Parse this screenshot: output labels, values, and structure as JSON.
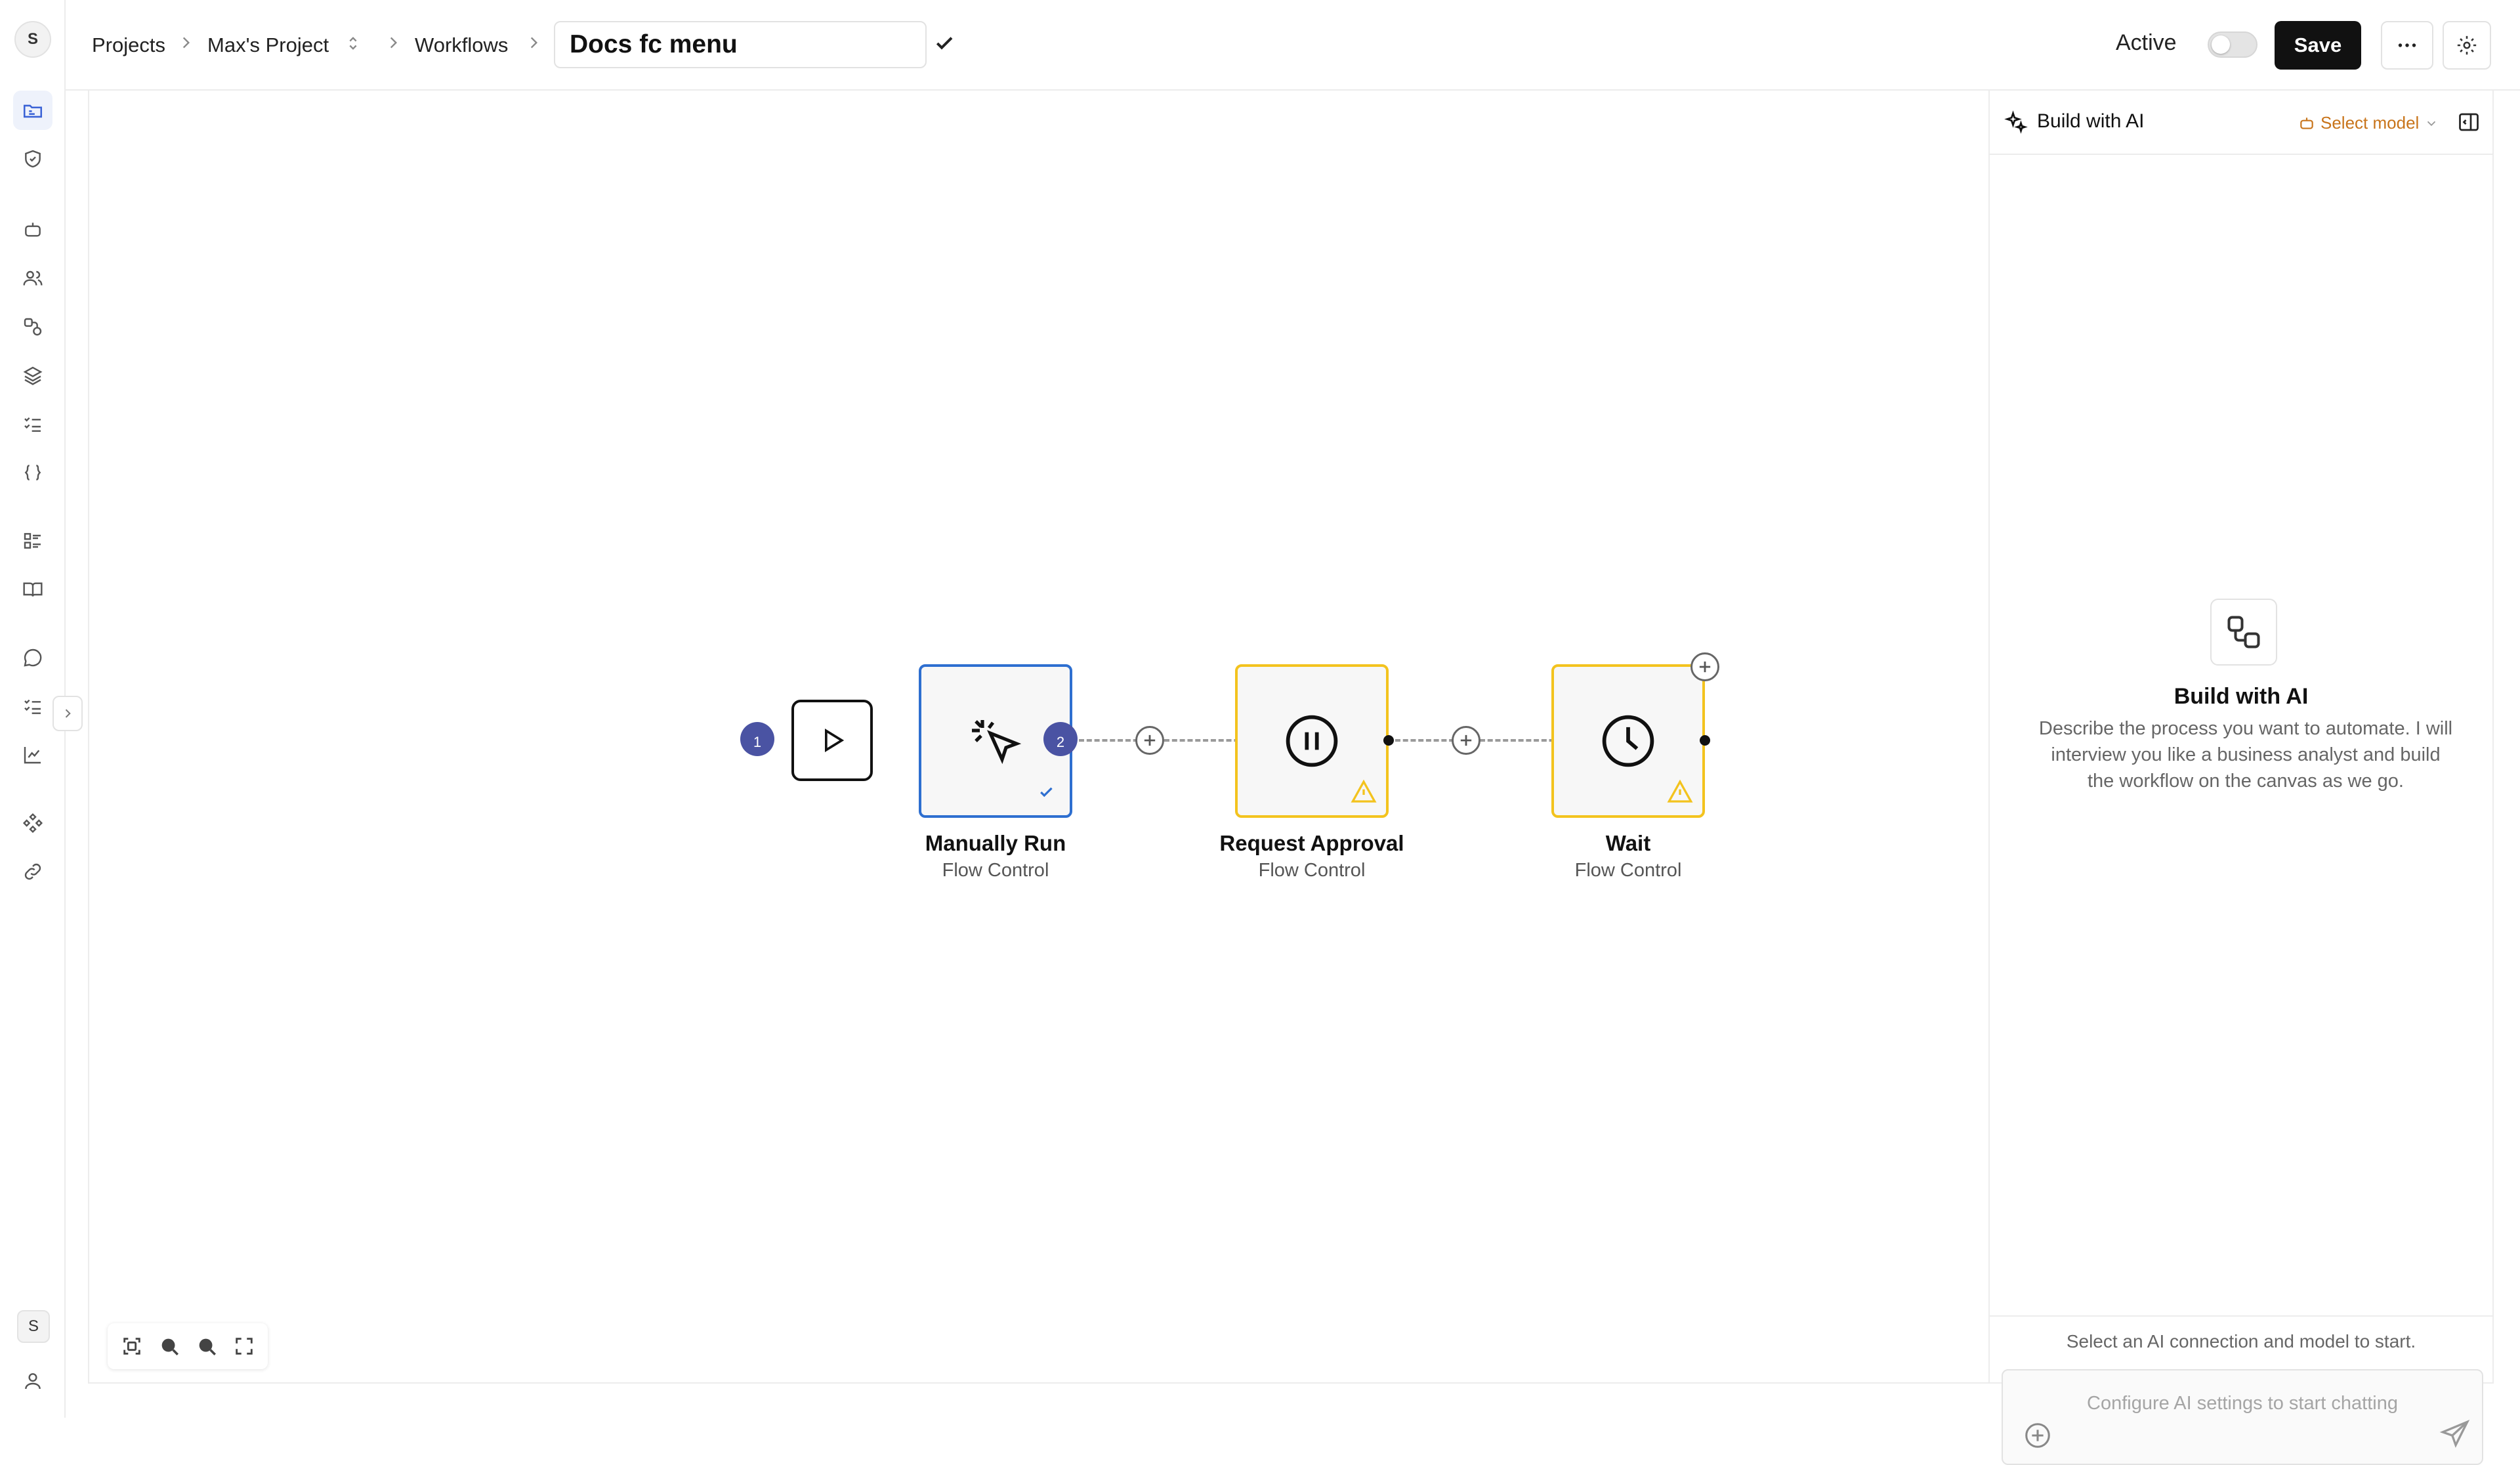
{
  "rail": {
    "avatar": "S",
    "bottom_badge": "S",
    "items": [
      "projects",
      "shield",
      "bot",
      "users",
      "connections",
      "layers",
      "tasks",
      "code",
      "list",
      "docs",
      "chat",
      "checklist",
      "analytics",
      "components",
      "links",
      "profile"
    ]
  },
  "header": {
    "breadcrumb": [
      "Projects",
      "Max's Project",
      "Workflows"
    ],
    "title": "Docs fc menu",
    "active_label": "Active",
    "active_on": false,
    "save_label": "Save"
  },
  "canvas": {
    "step_badges": [
      "1",
      "2"
    ],
    "nodes": [
      {
        "label": "Manually Run",
        "category": "Flow Control",
        "icon": "cursor-click-icon",
        "status": "ok"
      },
      {
        "label": "Request Approval",
        "category": "Flow Control",
        "icon": "pause-icon",
        "status": "warning"
      },
      {
        "label": "Wait",
        "category": "Flow Control",
        "icon": "clock-icon",
        "status": "warning"
      }
    ]
  },
  "ai_panel": {
    "title": "Build with AI",
    "model_label": "Select model",
    "empty_title": "Build with AI",
    "empty_desc": "Describe the process you want to automate. I will interview you like a business analyst and build the workflow on the canvas as we go.",
    "footer_hint": "Select an AI connection and model to start.",
    "input_placeholder": "Configure AI settings to start chatting"
  },
  "colors": {
    "accent": "#2e6fd0",
    "warning": "#f3c31e",
    "badge": "#4a53a3",
    "model": "#c8741a"
  }
}
